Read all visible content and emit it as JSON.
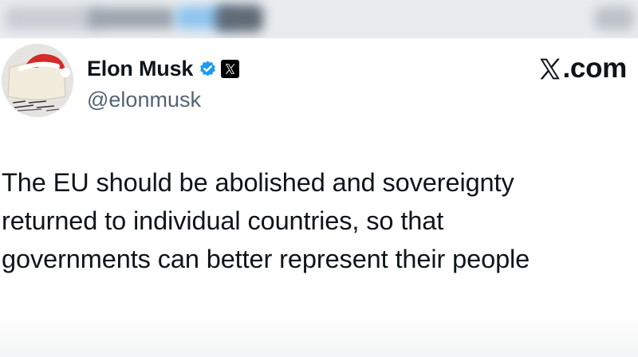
{
  "header_strip": {
    "blurred": true
  },
  "author": {
    "display_name": "Elon Musk",
    "handle": "@elonmusk",
    "verified_icon": "verified-badge-icon",
    "affiliation_icon": "x-logo-badge-icon",
    "avatar_icon": "avatar-santa-hat-icon"
  },
  "brand": {
    "suffix": ".com",
    "logo_icon": "x-logo-icon"
  },
  "tweet": {
    "lines": [
      "The EU should be abolished and sovereignty",
      "returned to individual countries, so that",
      "governments can better represent their people"
    ]
  },
  "colors": {
    "verified": "#1d9bf0",
    "text": "#0f1419",
    "muted": "#536471"
  }
}
